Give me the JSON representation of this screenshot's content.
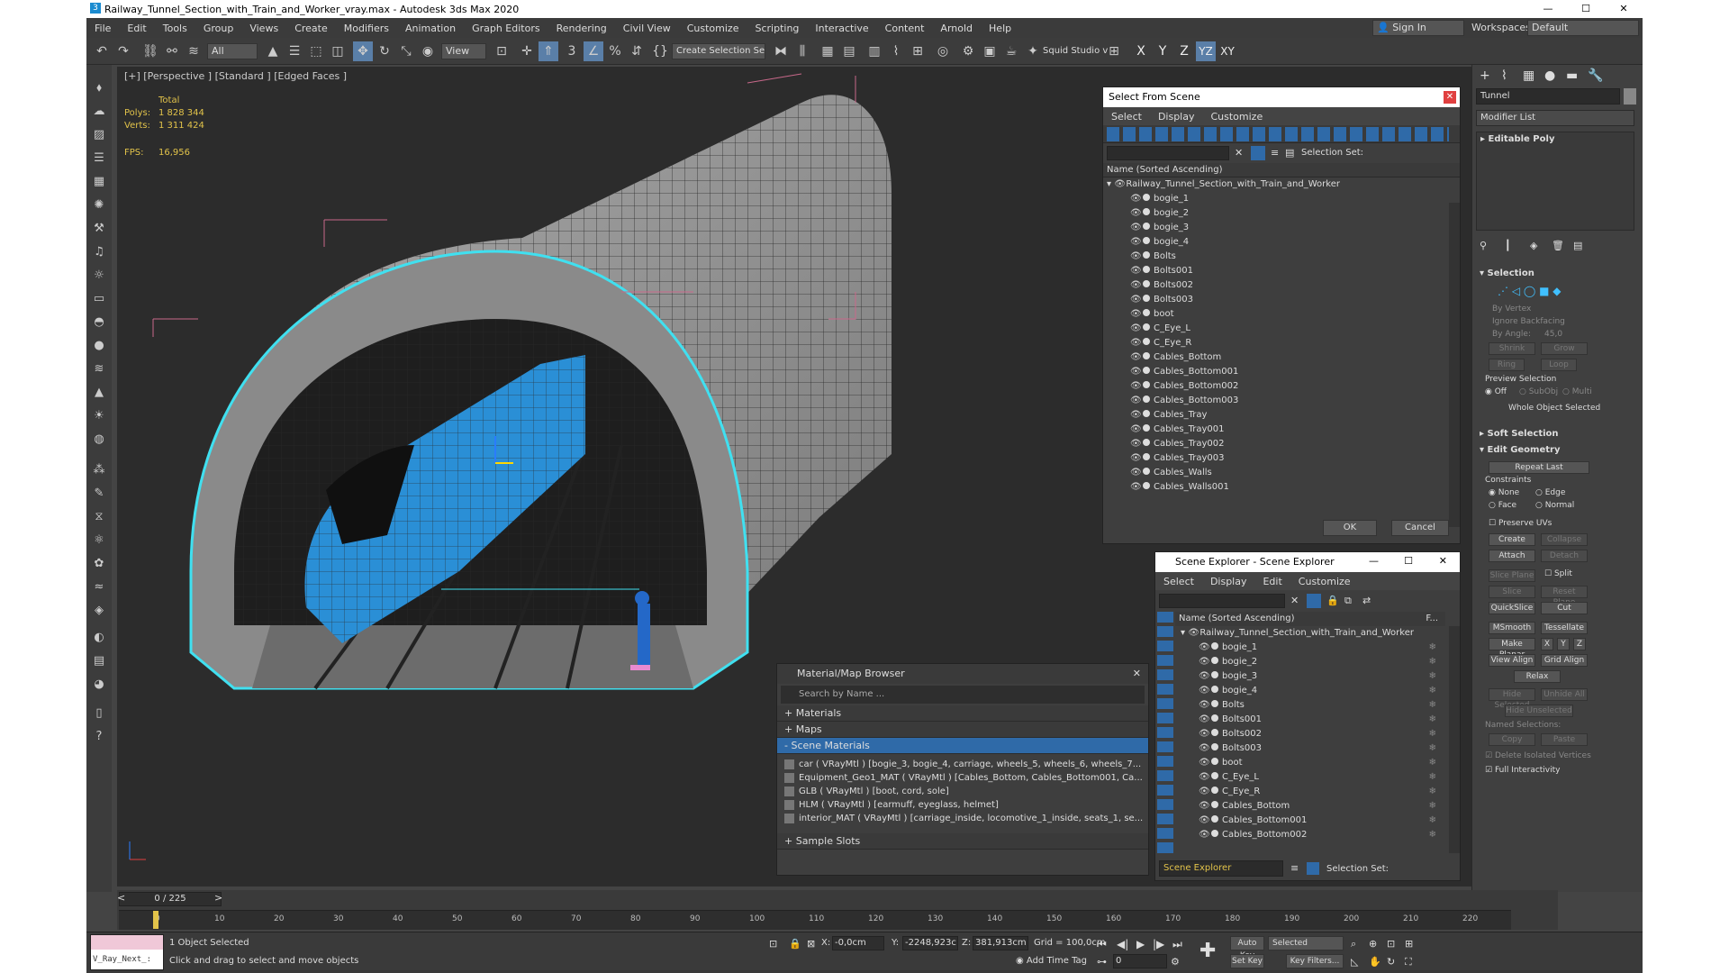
{
  "window": {
    "title": "Railway_Tunnel_Section_with_Train_and_Worker_vray.max - Autodesk 3ds Max 2020",
    "minimize": "—",
    "maximize": "☐",
    "close": "✕"
  },
  "menu": [
    "File",
    "Edit",
    "Tools",
    "Group",
    "Views",
    "Create",
    "Modifiers",
    "Animation",
    "Graph Editors",
    "Rendering",
    "Civil View",
    "Customize",
    "Scripting",
    "Interactive",
    "Content",
    "Arnold",
    "Help"
  ],
  "account": {
    "signin": "Sign In",
    "workspaces_label": "Workspaces:",
    "workspace": "Default"
  },
  "toolbar": {
    "filter": "All",
    "view": "View",
    "selection_set": "Create Selection Se",
    "squid": "Squid Studio v",
    "axes": [
      "X",
      "Y",
      "Z",
      "YZ",
      "XY"
    ]
  },
  "viewport": {
    "label": "[+] [Perspective ] [Standard ] [Edged Faces ]",
    "stats": {
      "total": "Total",
      "polys_label": "Polys:",
      "polys": "1 828 344",
      "verts_label": "Verts:",
      "verts": "1 311 424",
      "fps_label": "FPS:",
      "fps": "16,956"
    }
  },
  "select_from_scene": {
    "title": "Select From Scene",
    "menu": [
      "Select",
      "Display",
      "Customize"
    ],
    "selection_set_label": "Selection Set:",
    "column": "Name (Sorted Ascending)",
    "root": "Railway_Tunnel_Section_with_Train_and_Worker",
    "items": [
      "bogie_1",
      "bogie_2",
      "bogie_3",
      "bogie_4",
      "Bolts",
      "Bolts001",
      "Bolts002",
      "Bolts003",
      "boot",
      "C_Eye_L",
      "C_Eye_R",
      "Cables_Bottom",
      "Cables_Bottom001",
      "Cables_Bottom002",
      "Cables_Bottom003",
      "Cables_Tray",
      "Cables_Tray001",
      "Cables_Tray002",
      "Cables_Tray003",
      "Cables_Walls",
      "Cables_Walls001"
    ],
    "ok": "OK",
    "cancel": "Cancel"
  },
  "scene_explorer": {
    "title": "Scene Explorer - Scene Explorer",
    "menu": [
      "Select",
      "Display",
      "Edit",
      "Customize"
    ],
    "column": "Name (Sorted Ascending)",
    "column2": "F...",
    "root": "Railway_Tunnel_Section_with_Train_and_Worker",
    "items": [
      "bogie_1",
      "bogie_2",
      "bogie_3",
      "bogie_4",
      "Bolts",
      "Bolts001",
      "Bolts002",
      "Bolts003",
      "boot",
      "C_Eye_L",
      "C_Eye_R",
      "Cables_Bottom",
      "Cables_Bottom001",
      "Cables_Bottom002"
    ],
    "footer_name": "Scene Explorer",
    "selection_set_label": "Selection Set:"
  },
  "material_browser": {
    "title": "Material/Map Browser",
    "search_placeholder": "Search by Name ...",
    "sections": [
      "+ Materials",
      "+ Maps",
      "- Scene Materials"
    ],
    "materials": [
      "car  ( VRayMtl ) [bogie_3, bogie_4, carriage, wheels_5, wheels_6, wheels_7...",
      "Equipment_Geo1_MAT ( VRayMtl ) [Cables_Bottom, Cables_Bottom001, Ca...",
      "GLB  ( VRayMtl ) [boot, cord, sole]",
      "HLM  ( VRayMtl ) [earmuff, eyeglass, helmet]",
      "interior_MAT ( VRayMtl ) [carriage_inside, locomotive_1_inside, seats_1, se..."
    ],
    "sample_slots": "+ Sample Slots"
  },
  "command_panel": {
    "object_name": "Tunnel",
    "modifier_list": "Modifier List",
    "stack_item": "Editable Poly",
    "selection": "Selection",
    "by_vertex": "By Vertex",
    "ignore_backfacing": "Ignore Backfacing",
    "by_angle": "By Angle:",
    "angle_value": "45,0",
    "shrink": "Shrink",
    "grow": "Grow",
    "ring": "Ring",
    "loop": "Loop",
    "preview_selection": "Preview Selection",
    "off": "Off",
    "subobj": "SubObj",
    "multi": "Multi",
    "whole_object": "Whole Object Selected",
    "soft_selection": "Soft Selection",
    "edit_geometry": "Edit Geometry",
    "repeat_last": "Repeat Last",
    "constraints": "Constraints",
    "none": "None",
    "edge": "Edge",
    "face": "Face",
    "normal": "Normal",
    "preserve_uvs": "Preserve UVs",
    "create": "Create",
    "collapse": "Collapse",
    "attach": "Attach",
    "detach": "Detach",
    "slice_plane": "Slice Plane",
    "split": "Split",
    "slice": "Slice",
    "reset_plane": "Reset Plane",
    "quickslice": "QuickSlice",
    "cut": "Cut",
    "msmooth": "MSmooth",
    "tessellate": "Tessellate",
    "make_planar": "Make Planar",
    "x": "X",
    "y": "Y",
    "z": "Z",
    "view_align": "View Align",
    "grid_align": "Grid Align",
    "relax": "Relax",
    "hide_selected": "Hide Selected",
    "unhide_all": "Unhide All",
    "hide_unselected": "Hide Unselected",
    "named_selections": "Named Selections:",
    "copy": "Copy",
    "paste": "Paste",
    "delete_isolated": "Delete Isolated Vertices",
    "full_interactivity": "Full Interactivity"
  },
  "timeline": {
    "frame": "0 / 225",
    "ticks": [
      "0",
      "10",
      "20",
      "30",
      "40",
      "50",
      "60",
      "70",
      "80",
      "90",
      "100",
      "110",
      "120",
      "130",
      "140",
      "150",
      "160",
      "170",
      "180",
      "190",
      "200",
      "210",
      "220"
    ]
  },
  "status": {
    "script": "V_Ray_Next_:",
    "selected": "1 Object Selected",
    "hint": "Click and drag to select and move objects",
    "x_label": "X:",
    "x": "-0,0cm",
    "y_label": "Y:",
    "y": "-2248,923c",
    "z_label": "Z:",
    "z": "381,913cm",
    "grid": "Grid = 100,0cm",
    "add_time_tag": "Add Time Tag",
    "auto_key": "Auto Key",
    "set_key": "Set Key",
    "selected_dd": "Selected",
    "key_filters": "Key Filters...",
    "frame_field": "0"
  },
  "colors": {
    "accent": "#2f6aa8",
    "selection": "#40e0f0",
    "train": "#2a8fd6",
    "stats": "#e2c34a"
  }
}
